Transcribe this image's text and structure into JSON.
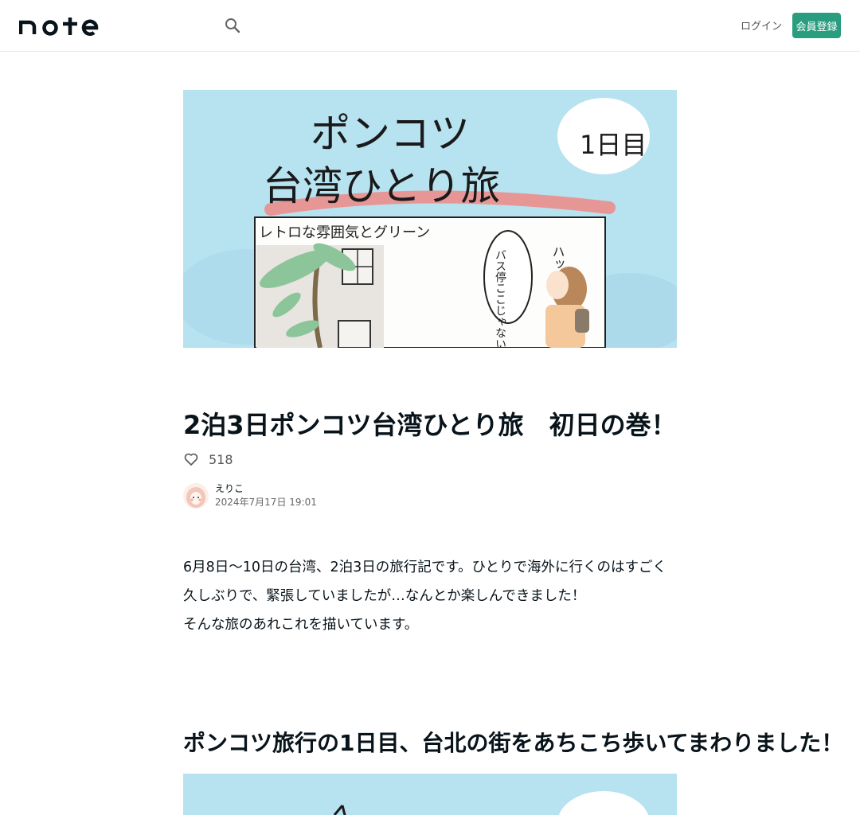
{
  "header": {
    "logo_text": "note",
    "login_label": "ログイン",
    "signup_label": "会員登録"
  },
  "hero": {
    "title_line1": "ポンコツ",
    "title_line2": "台湾ひとり旅",
    "day_badge": "1日目",
    "subtitle": "レトロな雰囲気とグリーン",
    "speech_bubble": "バス停ここじゃない!",
    "sound_effect": "ハッ"
  },
  "article": {
    "title": "2泊3日ポンコツ台湾ひとり旅　初日の巻！",
    "like_count": "518",
    "author_name": "えりこ",
    "date": "2024年7月17日 19:01",
    "body_lines": [
      "6月8日〜10日の台湾、2泊3日の旅行記です。ひとりで海外に行くのはすごく久しぶりで、緊張していましたが…なんとか楽しんできました！",
      "そんな旅のあれこれを描いています。"
    ],
    "section_heading": "ポンコツ旅行の1日目、台北の街をあちこち歩いてまわりました！"
  },
  "colors": {
    "accent": "#2a9d7f",
    "hero_bg": "#b6e1ef"
  }
}
